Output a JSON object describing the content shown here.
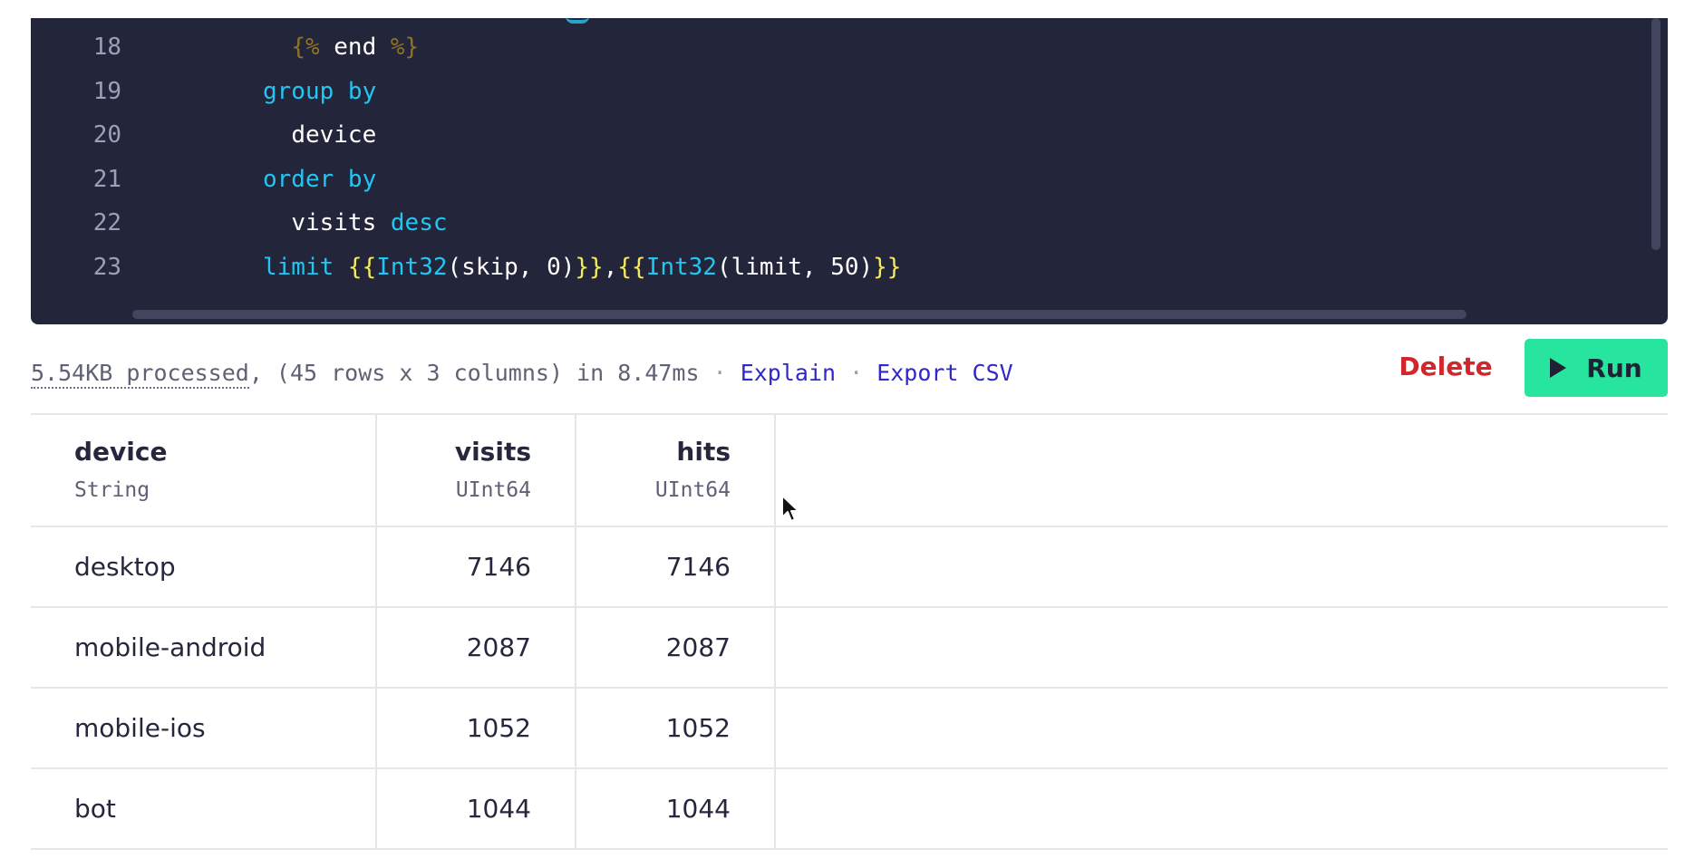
{
  "editor": {
    "lines": [
      {
        "num": "18",
        "indent": "  ",
        "tokens": [
          {
            "t": "{%",
            "c": "tpl"
          },
          {
            "t": " end ",
            "c": "plain"
          },
          {
            "t": "%}",
            "c": "tpl"
          }
        ]
      },
      {
        "num": "19",
        "indent": "",
        "tokens": [
          {
            "t": "group by",
            "c": "kw"
          }
        ]
      },
      {
        "num": "20",
        "indent": "  ",
        "tokens": [
          {
            "t": "device",
            "c": "plain"
          }
        ]
      },
      {
        "num": "21",
        "indent": "",
        "tokens": [
          {
            "t": "order by",
            "c": "kw"
          }
        ]
      },
      {
        "num": "22",
        "indent": "  ",
        "tokens": [
          {
            "t": "visits ",
            "c": "plain"
          },
          {
            "t": "desc",
            "c": "kw"
          }
        ]
      },
      {
        "num": "23",
        "indent": "",
        "tokens": [
          {
            "t": "limit ",
            "c": "kw"
          },
          {
            "t": "{{",
            "c": "brace"
          },
          {
            "t": "Int32",
            "c": "kw"
          },
          {
            "t": "(skip, 0)",
            "c": "plain"
          },
          {
            "t": "}}",
            "c": "brace"
          },
          {
            "t": ",",
            "c": "plain"
          },
          {
            "t": "{{",
            "c": "brace"
          },
          {
            "t": "Int32",
            "c": "kw"
          },
          {
            "t": "(limit, 50)",
            "c": "plain"
          },
          {
            "t": "}}",
            "c": "brace"
          }
        ]
      }
    ]
  },
  "status": {
    "processed": "5.54KB processed",
    "summary": ", (45 rows x 3 columns) in 8.47ms",
    "separator": " · ",
    "explain_label": "Explain",
    "export_label": "Export CSV"
  },
  "actions": {
    "delete_label": "Delete",
    "run_label": "Run"
  },
  "table": {
    "columns": [
      {
        "name": "device",
        "type": "String"
      },
      {
        "name": "visits",
        "type": "UInt64"
      },
      {
        "name": "hits",
        "type": "UInt64"
      }
    ],
    "rows": [
      [
        "desktop",
        "7146",
        "7146"
      ],
      [
        "mobile-android",
        "2087",
        "2087"
      ],
      [
        "mobile-ios",
        "1052",
        "1052"
      ],
      [
        "bot",
        "1044",
        "1044"
      ]
    ]
  },
  "colors": {
    "editor_bg": "#23263b",
    "keyword": "#23c5f2",
    "template_tag": "#8e7326",
    "brace": "#f4ea5d",
    "run_button": "#27e59f",
    "delete_text": "#d3262c",
    "link": "#3028c7"
  }
}
